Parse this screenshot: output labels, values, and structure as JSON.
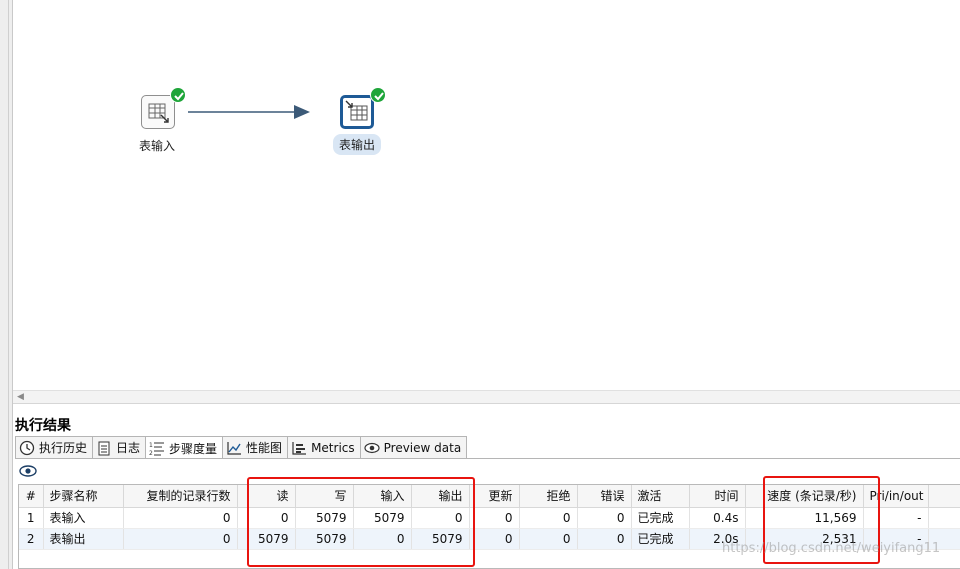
{
  "canvas": {
    "steps": [
      {
        "label": "表输入",
        "status": "completed"
      },
      {
        "label": "表输出",
        "status": "completed"
      }
    ]
  },
  "results": {
    "title": "执行结果",
    "tabs": [
      {
        "label": "执行历史",
        "icon": "history-icon"
      },
      {
        "label": "日志",
        "icon": "log-icon"
      },
      {
        "label": "步骤度量",
        "icon": "step-metrics-icon",
        "active": true
      },
      {
        "label": "性能图",
        "icon": "performance-chart-icon"
      },
      {
        "label": "Metrics",
        "icon": "metrics-icon"
      },
      {
        "label": "Preview data",
        "icon": "preview-eye-icon"
      }
    ],
    "table": {
      "headers": [
        "#",
        "步骤名称",
        "复制的记录行数",
        "读",
        "写",
        "输入",
        "输出",
        "更新",
        "拒绝",
        "错误",
        "激活",
        "时间",
        "速度 (条记录/秒)",
        "Pri/in/out"
      ],
      "rows": [
        [
          "1",
          "表输入",
          "0",
          "0",
          "5079",
          "5079",
          "0",
          "0",
          "0",
          "0",
          "已完成",
          "0.4s",
          "11,569",
          "-"
        ],
        [
          "2",
          "表输出",
          "0",
          "5079",
          "5079",
          "0",
          "5079",
          "0",
          "0",
          "0",
          "已完成",
          "2.0s",
          "2,531",
          "-"
        ]
      ]
    }
  },
  "watermark": "https://blog.csdn.net/weiyifang11",
  "colors": {
    "accent_selected": "#1e5a96",
    "success_check": "#1ea539",
    "highlight_box": "#e8140f"
  }
}
